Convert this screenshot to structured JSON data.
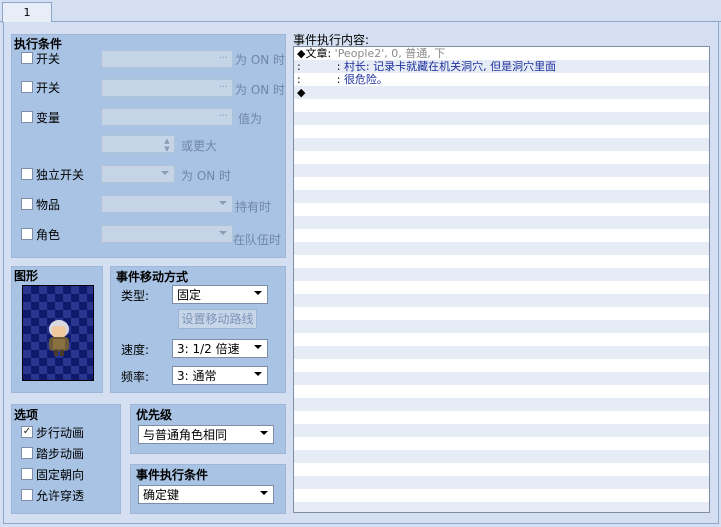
{
  "tab": {
    "label": "1"
  },
  "conditions": {
    "title": "执行条件",
    "switch1": {
      "label": "开关",
      "suffix": "为 ON 时"
    },
    "switch2": {
      "label": "开关",
      "suffix": "为 ON 时"
    },
    "variable": {
      "label": "变量",
      "suffix": "值为",
      "suffix2": "或更大"
    },
    "self_switch": {
      "label": "独立开关",
      "suffix": "为 ON 时"
    },
    "item": {
      "label": "物品",
      "suffix": "持有时"
    },
    "actor": {
      "label": "角色",
      "suffix": "在队伍时"
    }
  },
  "graphic": {
    "title": "图形"
  },
  "movement": {
    "title": "事件移动方式",
    "type_label": "类型:",
    "type_value": "固定",
    "route_button": "设置移动路线",
    "speed_label": "速度:",
    "speed_value": "3: 1/2 倍速",
    "freq_label": "频率:",
    "freq_value": "3: 通常"
  },
  "options": {
    "title": "选项",
    "items": [
      {
        "label": "步行动画",
        "checked": true
      },
      {
        "label": "踏步动画",
        "checked": false
      },
      {
        "label": "固定朝向",
        "checked": false
      },
      {
        "label": "允许穿透",
        "checked": false
      }
    ]
  },
  "priority": {
    "title": "优先级",
    "value": "与普通角色相同"
  },
  "trigger": {
    "title": "事件执行条件",
    "value": "确定键"
  },
  "contents": {
    "title": "事件执行内容:",
    "lines": [
      {
        "prefix": "◆文章:",
        "grey": "'People2', 0, 普通, 下",
        "blue": ""
      },
      {
        "prefix": ":",
        "grey": ":",
        "blue": "村长: 记录卡就藏在机关洞穴, 但是洞穴里面"
      },
      {
        "prefix": ":",
        "grey": ":",
        "blue": "很危险。"
      },
      {
        "prefix": "◆",
        "grey": "",
        "blue": ""
      }
    ]
  },
  "colors": {
    "panel": "#a9c3e5",
    "background": "#d4e0f2",
    "text_blue": "#1c2f9c"
  }
}
